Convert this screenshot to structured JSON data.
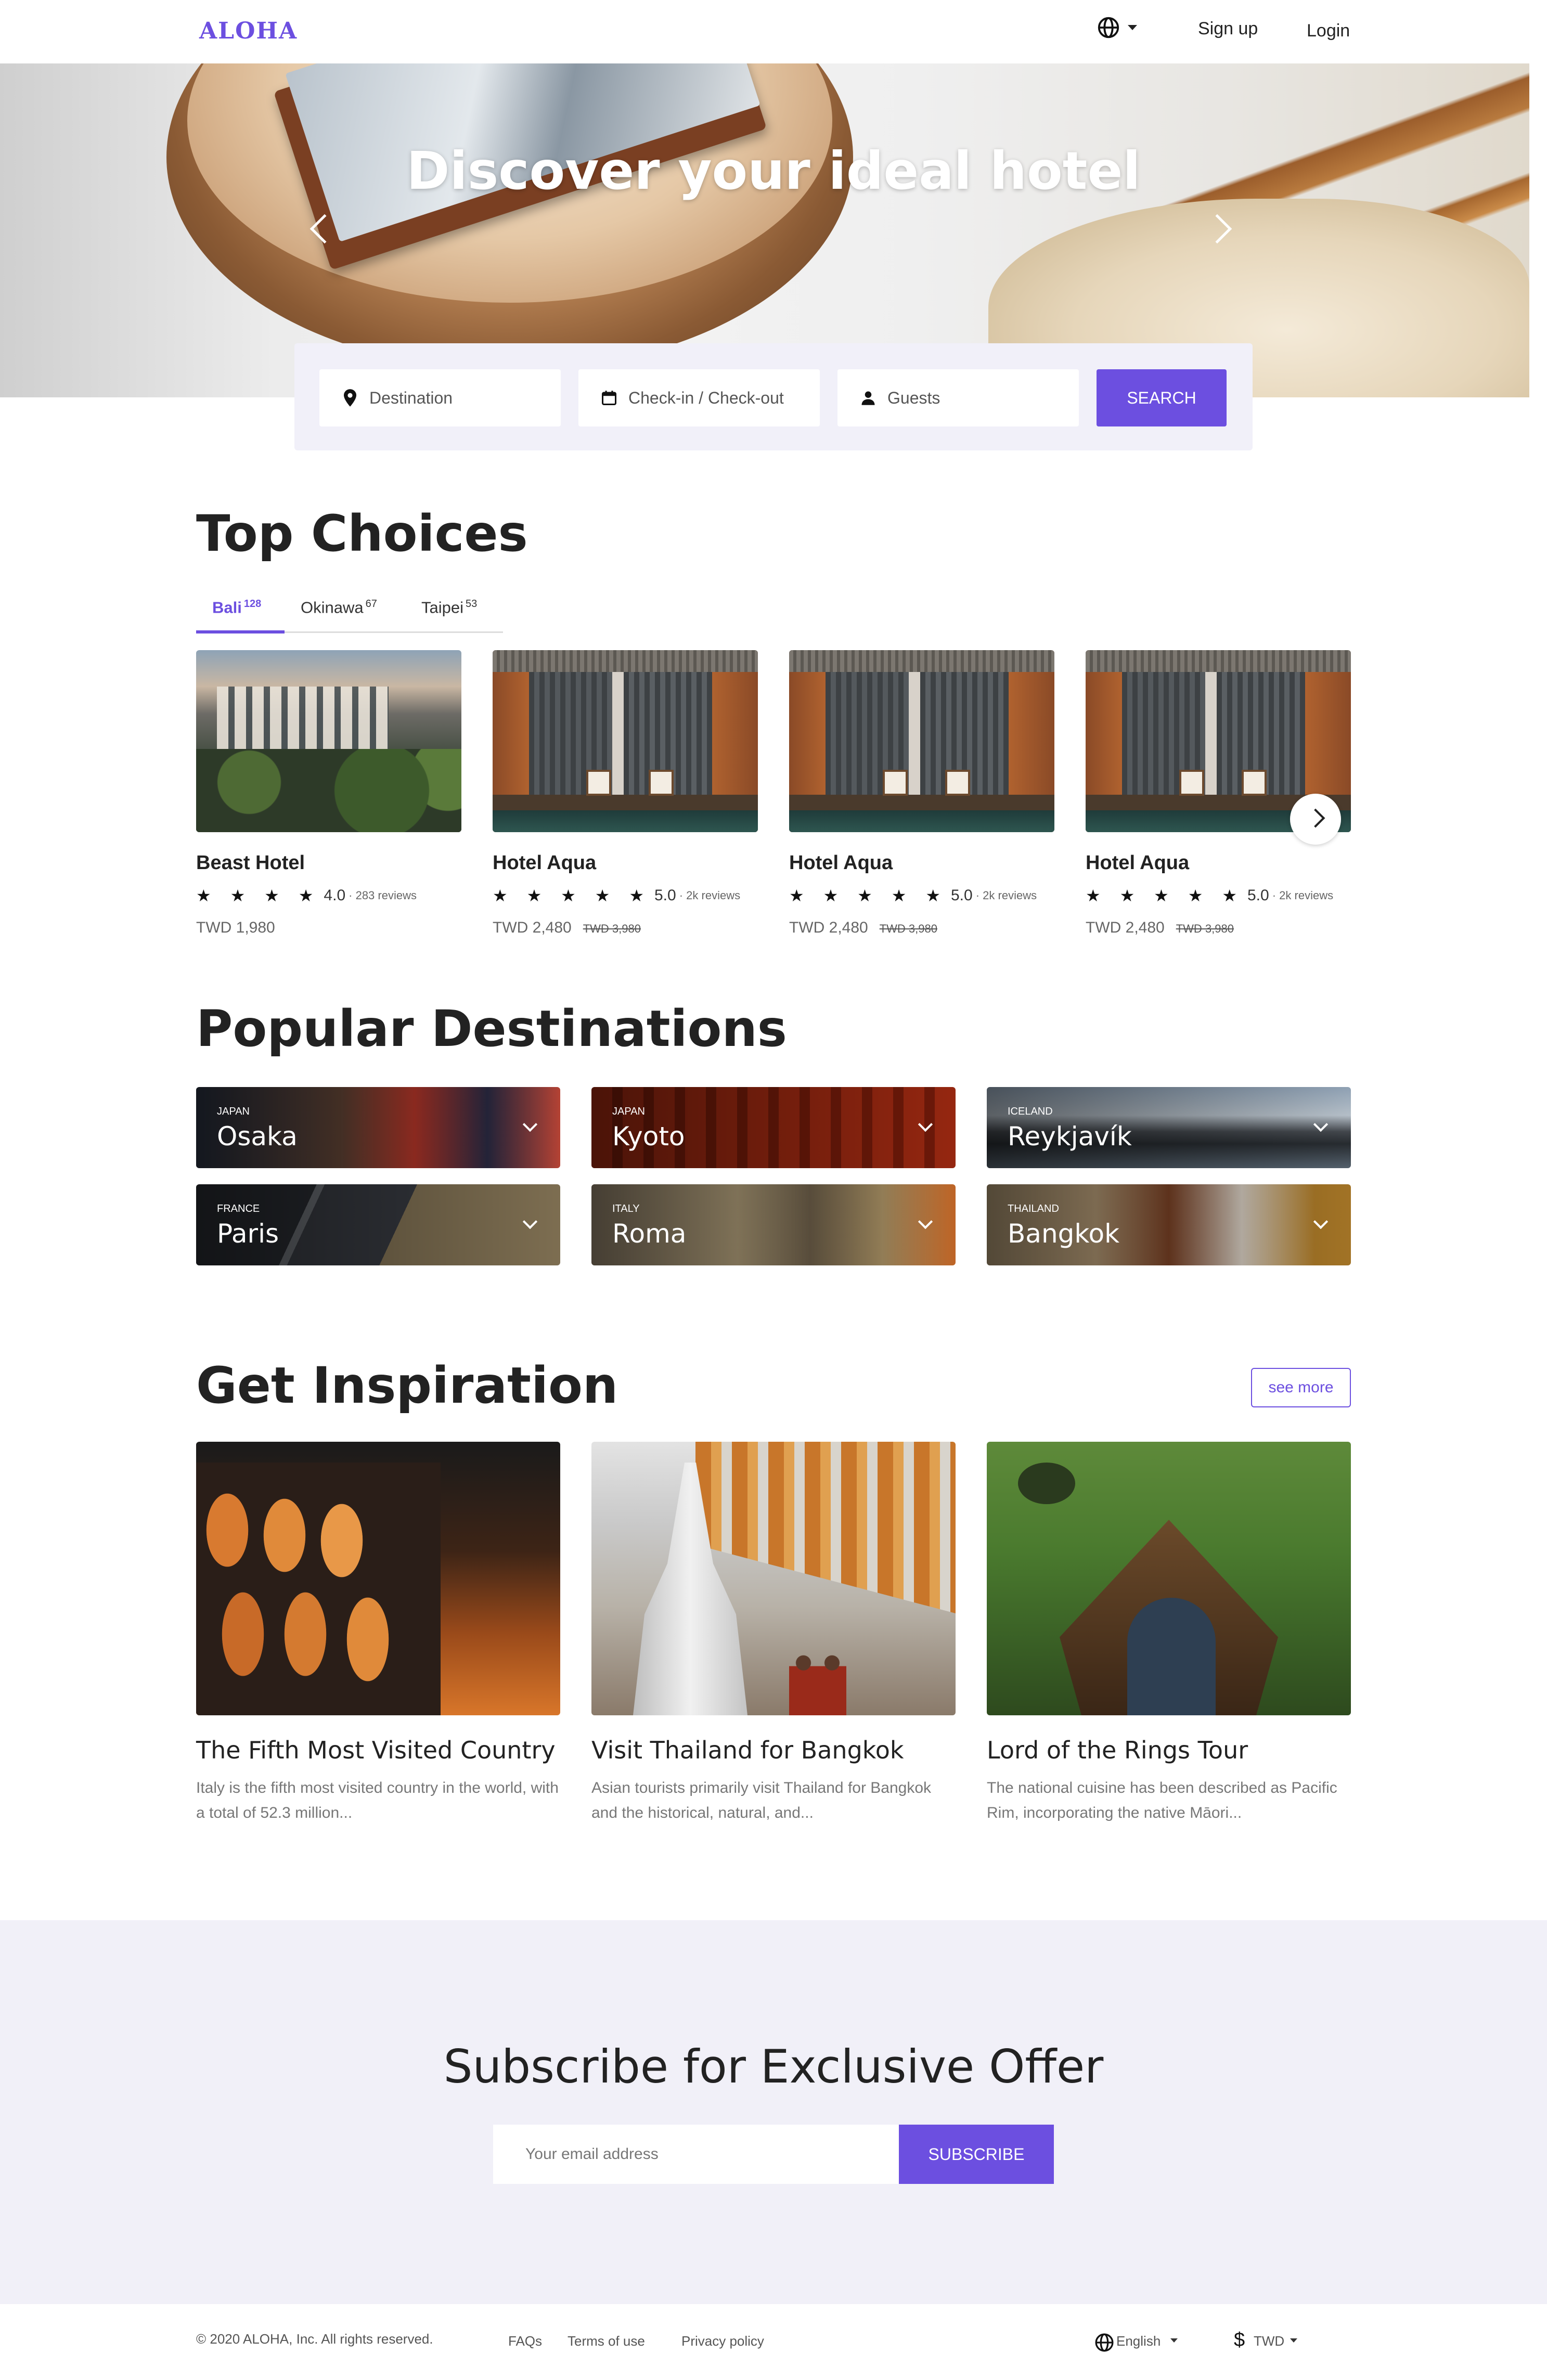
{
  "nav": {
    "logo": "ALOHA",
    "signup": "Sign up",
    "login": "Login"
  },
  "hero": {
    "title": "Discover your ideal hotel"
  },
  "search": {
    "destination_placeholder": "Destination",
    "dates_placeholder": "Check-in / Check-out",
    "guests_placeholder": "Guests",
    "button": "SEARCH"
  },
  "top_choices": {
    "title": "Top Choices",
    "tabs": [
      {
        "label": "Bali",
        "count": "128"
      },
      {
        "label": "Okinawa",
        "count": "67"
      },
      {
        "label": "Taipei",
        "count": "53"
      }
    ],
    "hotels": [
      {
        "name": "Beast Hotel",
        "stars": "★ ★ ★ ★",
        "rating": "4.0",
        "reviews": "· 283 reviews",
        "price": "TWD 1,980",
        "old_price": ""
      },
      {
        "name": "Hotel Aqua",
        "stars": "★ ★ ★ ★ ★",
        "rating": "5.0",
        "reviews": "· 2k reviews",
        "price": "TWD 2,480",
        "old_price": "TWD 3,980"
      },
      {
        "name": "Hotel Aqua",
        "stars": "★ ★ ★ ★ ★",
        "rating": "5.0",
        "reviews": "· 2k reviews",
        "price": "TWD 2,480",
        "old_price": "TWD 3,980"
      },
      {
        "name": "Hotel Aqua",
        "stars": "★ ★ ★ ★ ★",
        "rating": "5.0",
        "reviews": "· 2k reviews",
        "price": "TWD 2,480",
        "old_price": "TWD 3,980"
      }
    ]
  },
  "popular": {
    "title": "Popular Destinations",
    "destinations": [
      {
        "country": "JAPAN",
        "city": "Osaka"
      },
      {
        "country": "JAPAN",
        "city": "Kyoto"
      },
      {
        "country": "ICELAND",
        "city": "Reykjavík"
      },
      {
        "country": "FRANCE",
        "city": "Paris"
      },
      {
        "country": "ITALY",
        "city": "Roma"
      },
      {
        "country": "THAILAND",
        "city": "Bangkok"
      }
    ]
  },
  "inspiration": {
    "title": "Get Inspiration",
    "see_more": "see more",
    "articles": [
      {
        "title": "The Fifth Most Visited Country",
        "desc": "Italy is the fifth most visited country in the world, with a total of 52.3 million..."
      },
      {
        "title": "Visit Thailand for Bangkok",
        "desc": "Asian tourists primarily visit Thailand for Bangkok and the historical, natural, and..."
      },
      {
        "title": "Lord of the Rings Tour",
        "desc": "The national cuisine has been described as Pacific Rim, incorporating the native Māori..."
      }
    ]
  },
  "subscribe": {
    "title": "Subscribe for Exclusive Offer",
    "email_placeholder": "Your email address",
    "button": "SUBSCRIBE"
  },
  "footer": {
    "copyright": "© 2020 ALOHA, Inc. All rights reserved.",
    "links": [
      "FAQs",
      "Terms of use",
      "Privacy policy"
    ],
    "language": "English",
    "currency": "TWD"
  },
  "colors": {
    "accent": "#6c4fe0",
    "subscribe_bg": "#f1f0f8",
    "search_bg": "#f1f0f9"
  }
}
